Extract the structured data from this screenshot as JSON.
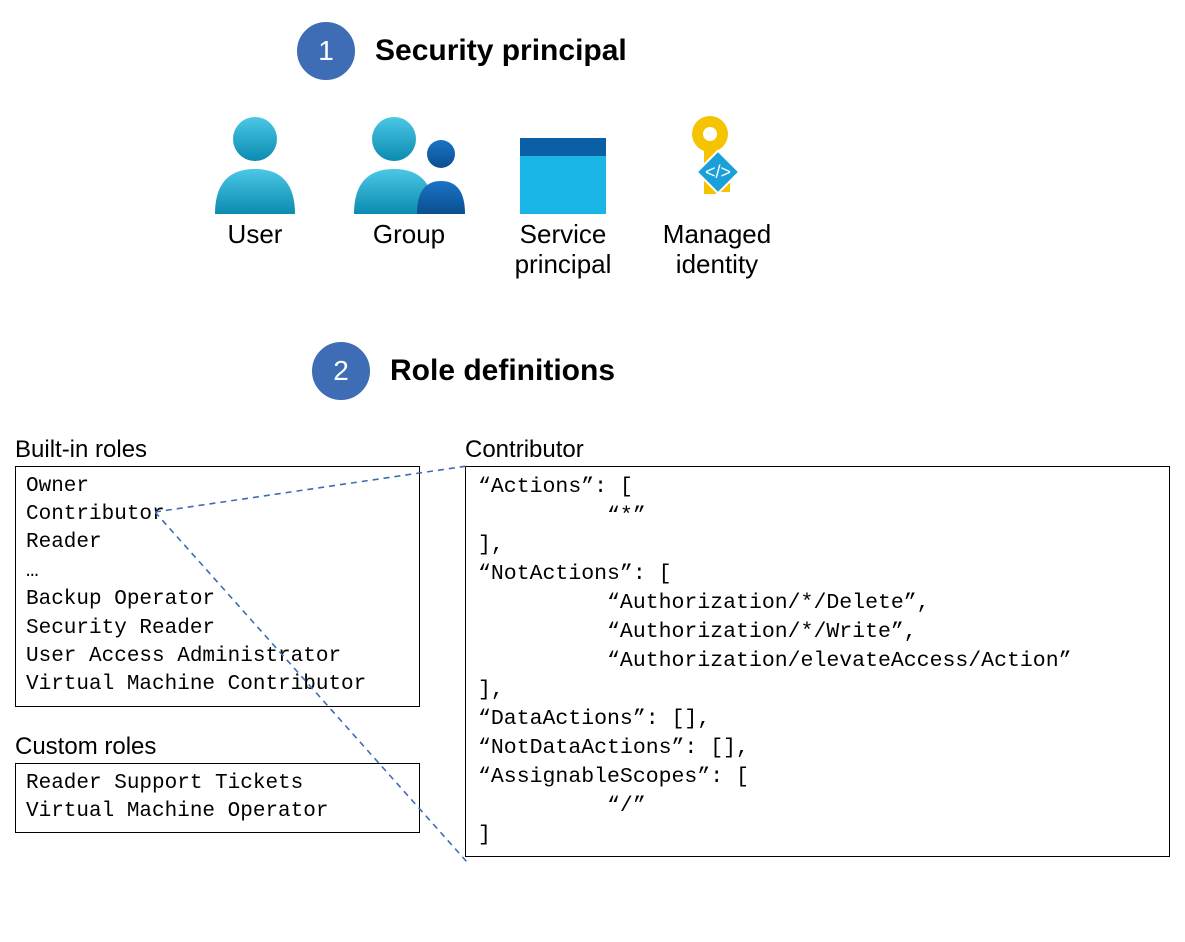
{
  "sections": {
    "security_principal": {
      "number": "1",
      "title": "Security principal"
    },
    "role_definitions": {
      "number": "2",
      "title": "Role definitions"
    }
  },
  "principals": {
    "user": "User",
    "group": "Group",
    "service_principal": "Service\nprincipal",
    "managed_identity": "Managed\nidentity"
  },
  "roles": {
    "builtin_label": "Built-in roles",
    "builtin_list": "Owner\nContributor\nReader\n…\nBackup Operator\nSecurity Reader\nUser Access Administrator\nVirtual Machine Contributor",
    "custom_label": "Custom roles",
    "custom_list": "Reader Support Tickets\nVirtual Machine Operator"
  },
  "contributor": {
    "label": "Contributor",
    "json_text": "“Actions”: [\n          “*”\n],\n“NotActions”: [\n          “Authorization/*/Delete”,\n          “Authorization/*/Write”,\n          “Authorization/elevateAccess/Action”\n],\n“DataActions”: [],\n“NotDataActions”: [],\n“AssignableScopes”: [\n          “/”\n]"
  },
  "colors": {
    "badge": "#3e6db5",
    "azure_light": "#2fb4d8",
    "azure_dark": "#0a6e8a",
    "key_yellow": "#f6c300",
    "card_blue": "#00a1e0",
    "card_header": "#0a5fa5"
  }
}
